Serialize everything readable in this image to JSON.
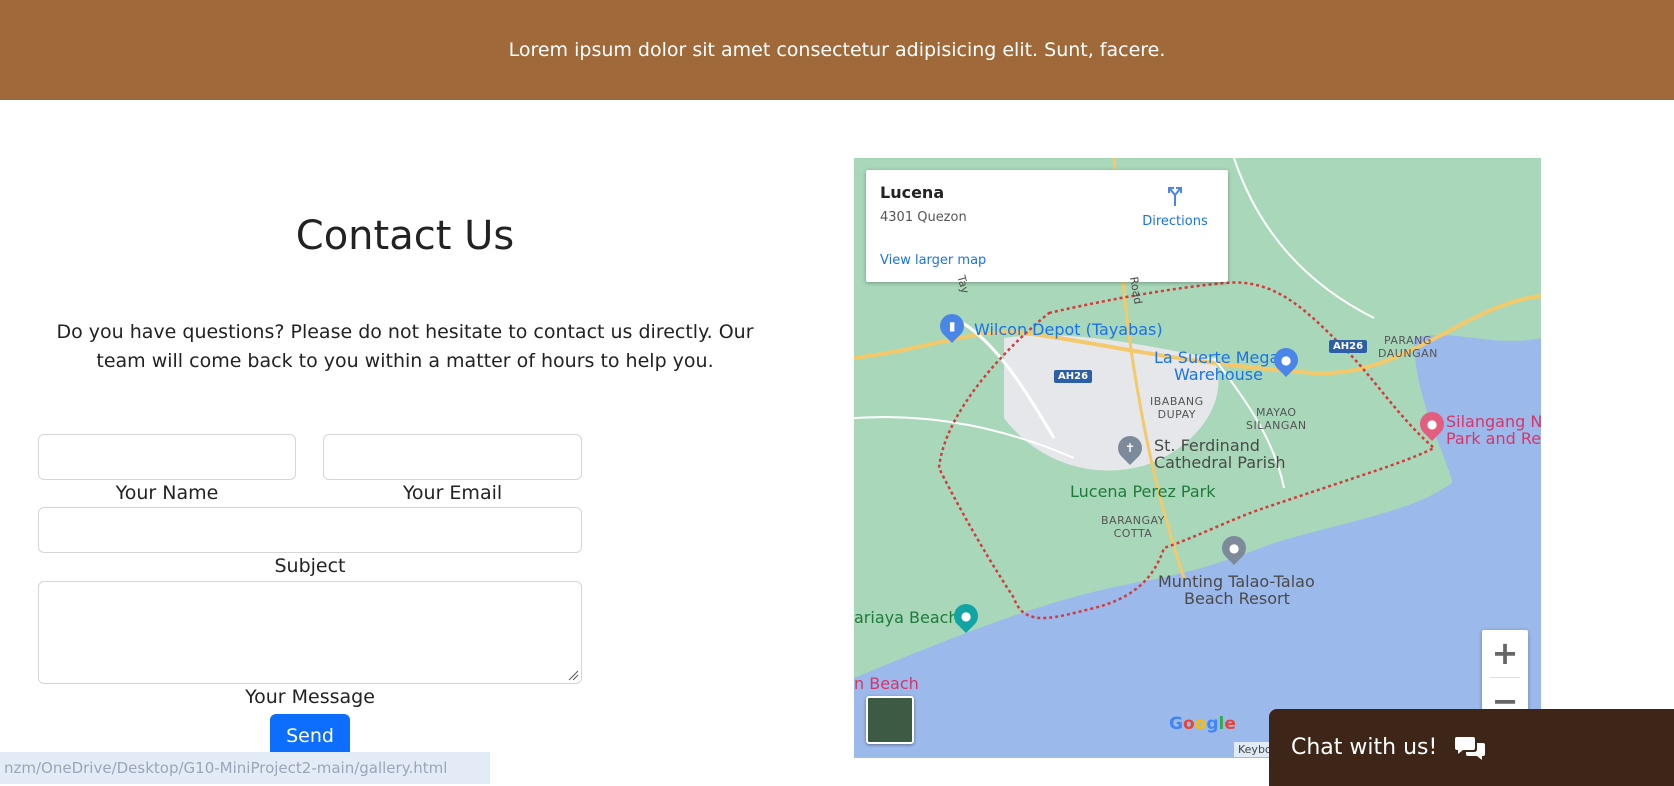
{
  "banner": {
    "text": "Lorem ipsum dolor sit amet consectetur adipisicing elit. Sunt, facere."
  },
  "contact": {
    "title": "Contact Us",
    "description": "Do you have questions? Please do not hesitate to contact us directly. Our team will come back to you within a matter of hours to help you."
  },
  "form": {
    "name": {
      "label": "Your Name",
      "value": ""
    },
    "email": {
      "label": "Your Email",
      "value": ""
    },
    "subject": {
      "label": "Subject",
      "value": ""
    },
    "message": {
      "label": "Your Message",
      "value": ""
    },
    "send_label": "Send"
  },
  "status_bar": {
    "url": "nzm/OneDrive/Desktop/G10-MiniProject2-main/gallery.html"
  },
  "map": {
    "card": {
      "title": "Lucena",
      "address": "4301 Quezon",
      "directions_label": "Directions",
      "larger_map_label": "View larger map"
    },
    "labels": {
      "wilcon": "Wilcon Depot (Tayabas)",
      "la_suerte_1": "La Suerte Mega",
      "la_suerte_2": "Warehouse",
      "ibabang_1": "IBABANG",
      "ibabang_2": "DUPAY",
      "mayao_1": "MAYAO",
      "mayao_2": "SILANGAN",
      "parang_1": "PARANG",
      "parang_2": "DAUNGAN",
      "st_ferdinand_1": "St. Ferdinand",
      "st_ferdinand_2": "Cathedral Parish",
      "perez_park": "Lucena Perez Park",
      "barangay_1": "BARANGAY",
      "barangay_2": "COTTA",
      "munting_1": "Munting Talao-Talao",
      "munting_2": "Beach Resort",
      "sariaya": "ariaya Beach",
      "silangang_1": "Silangang Na",
      "silangang_2": "Park and Res",
      "n_beach": "n Beach",
      "road_ah26_a": "AH26",
      "road_ah26_b": "AH26",
      "road": "Road",
      "tay": "Tay"
    },
    "zoom_in": "+",
    "zoom_out": "−",
    "google": "Google",
    "keyboard": "Keybo"
  },
  "chat": {
    "label": "Chat with us!"
  },
  "colors": {
    "banner": "#a0693a",
    "send": "#0d6efd",
    "chat": "#3d2617",
    "link": "#1a73e8"
  }
}
